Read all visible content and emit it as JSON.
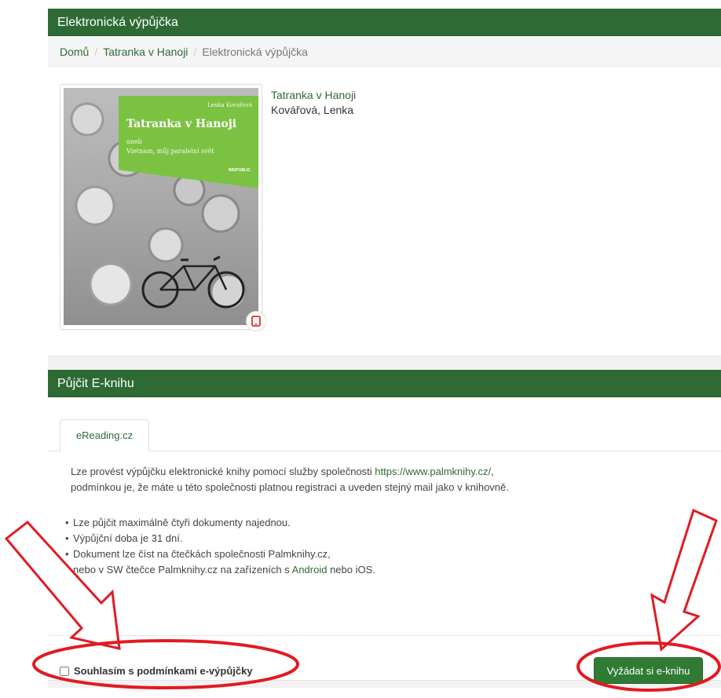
{
  "panel1": {
    "title": "Elektronická výpůjčka",
    "breadcrumb": {
      "home": "Domů",
      "book": "Tatranka v Hanoji",
      "current": "Elektronická výpůjčka",
      "separator": "/"
    },
    "cover": {
      "author": "Lenka Kovářová",
      "title": "Tatranka v Hanoji",
      "aneb": "aneb",
      "subtitle": "Vietnam, můj paralelní svět",
      "publisher": "WEIPUBLIC",
      "accent_color": "#7cc242"
    },
    "book": {
      "title": "Tatranka v Hanoji",
      "author": "Kovářová, Lenka"
    },
    "device_icon": "tablet-icon"
  },
  "panel2": {
    "title": "Půjčit E-knihu",
    "tab": "eReading.cz",
    "desc_line1_prefix": "Lze provést výpůjčku elektronické knihy pomocí služby společnosti ",
    "desc_link": "https://www.palmknihy.cz/",
    "desc_line1_suffix": ",",
    "desc_line2": "podmínkou je, že máte u této společnosti platnou registraci a uveden stejný mail jako v knihovně.",
    "rules": [
      "Lze půjčit maximálně čtyři dokumenty najednou.",
      "Výpůjční doba je 31 dní.",
      "Dokument lze číst na čtečkách společnosti Palmknihy.cz,"
    ],
    "rule4_prefix": "nebo v SW čtečce Palmknihy.cz na zařízeních s ",
    "rule4_link": "Android",
    "rule4_suffix": " nebo iOS.",
    "agree_label": "Souhlasím s podmínkami e-výpůjčky",
    "request_button": "Vyžádat si e-knihu"
  },
  "colors": {
    "header_green": "#2e6b34",
    "button_green": "#2f7b33",
    "annotation_red": "#e11b22"
  }
}
